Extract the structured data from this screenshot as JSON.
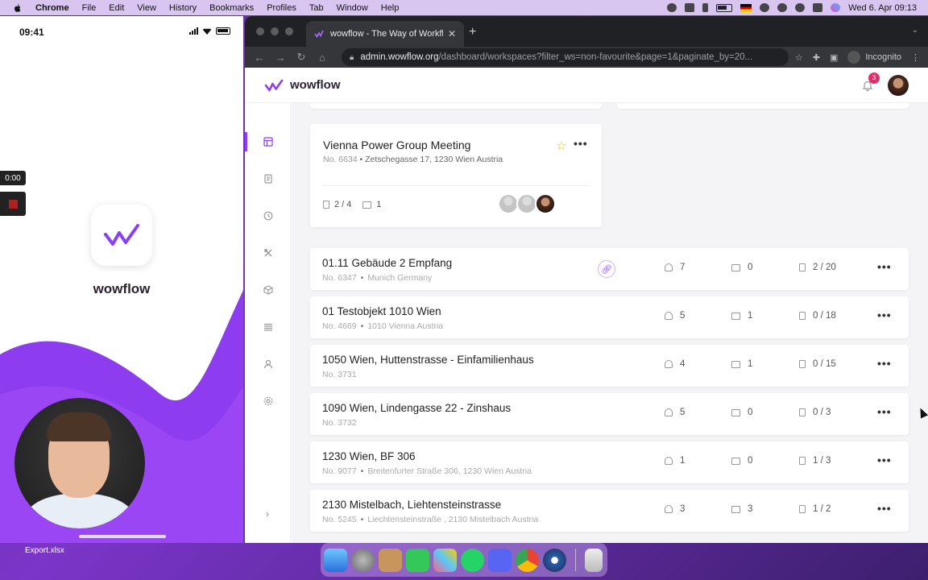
{
  "menubar": {
    "app": "Chrome",
    "items": [
      "File",
      "Edit",
      "View",
      "History",
      "Bookmarks",
      "Profiles",
      "Tab",
      "Window",
      "Help"
    ],
    "datetime": "Wed 6. Apr  09:13"
  },
  "phone": {
    "time": "09:41",
    "app_name": "wowflow",
    "rec_time": "0:00"
  },
  "desktop": {
    "file_label": "Export.xlsx"
  },
  "browser": {
    "tab_title": "wowflow - The Way of Workflow",
    "url_host": "admin.wowflow.org",
    "url_path": "/dashboard/workspaces?filter_ws=non-favourite&page=1&paginate_by=20...",
    "incognito_label": "Incognito"
  },
  "app": {
    "brand": "wowflow",
    "notifications": "3",
    "accent": "#8a3ffc"
  },
  "favorite": {
    "title": "Vienna Power Group Meeting",
    "number": "No. 6634",
    "address": "Zetschegasse 17, 1230 Wien Austria",
    "docs": "2 / 4",
    "folders": "1"
  },
  "rows": [
    {
      "name": "01.11 Gebäude 2 Empfang",
      "number": "No. 6347",
      "address": "Munich Germany",
      "users": "7",
      "folders": "0",
      "docs": "2 / 20"
    },
    {
      "name": "01 Testobjekt 1010 Wien",
      "number": "No. 4669",
      "address": "1010 Vienna Austria",
      "users": "5",
      "folders": "1",
      "docs": "0 / 18"
    },
    {
      "name": "1050 Wien, Huttenstrasse - Einfamilienhaus",
      "number": "No. 3731",
      "address": "",
      "users": "4",
      "folders": "1",
      "docs": "0 / 15"
    },
    {
      "name": "1090 Wien, Lindengasse 22 - Zinshaus",
      "number": "No. 3732",
      "address": "",
      "users": "5",
      "folders": "0",
      "docs": "0 / 3"
    },
    {
      "name": "1230 Wien, BF 306",
      "number": "No. 9077",
      "address": "Breitenfurter Straße 306, 1230 Wien Austria",
      "users": "1",
      "folders": "0",
      "docs": "1 / 3"
    },
    {
      "name": "2130 Mistelbach, Liehtensteinstrasse",
      "number": "No. 5245",
      "address": "Liechtensteinstraße , 2130 Mistelbach Austria",
      "users": "3",
      "folders": "3",
      "docs": "1 / 2"
    }
  ]
}
